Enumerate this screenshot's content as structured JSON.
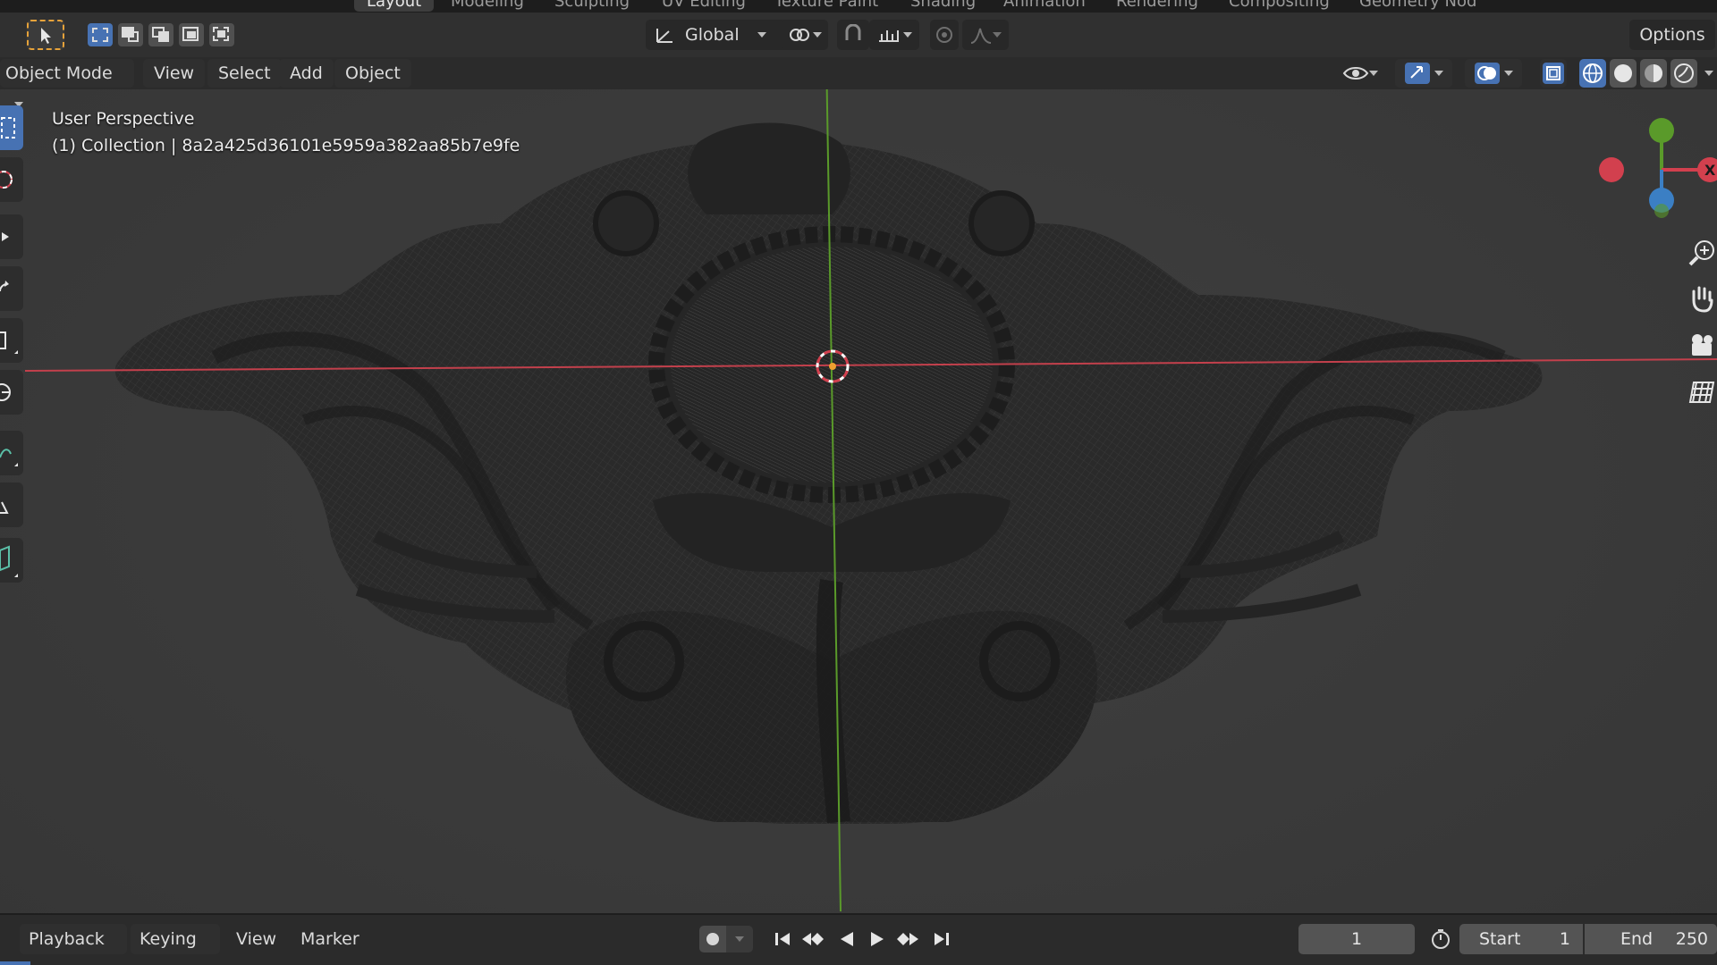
{
  "workspace_tabs": [
    {
      "label": "Layout",
      "active": true
    },
    {
      "label": "Modeling",
      "active": false
    },
    {
      "label": "Sculpting",
      "active": false
    },
    {
      "label": "UV Editing",
      "active": false
    },
    {
      "label": "Texture Paint",
      "active": false
    },
    {
      "label": "Shading",
      "active": false
    },
    {
      "label": "Animation",
      "active": false
    },
    {
      "label": "Rendering",
      "active": false
    },
    {
      "label": "Compositing",
      "active": false
    },
    {
      "label": "Geometry Nod",
      "active": false
    }
  ],
  "header": {
    "transform_orientation": "Global",
    "options_label": "Options"
  },
  "viewport_header": {
    "mode": "Object Mode",
    "menus": [
      "View",
      "Select",
      "Add",
      "Object"
    ]
  },
  "viewport": {
    "perspective_label": "User Perspective",
    "collection_label": "(1) Collection | 8a2a425d36101e5959a382aa85b7e9fe",
    "axis_x_color": "#d2404e",
    "axis_y_color": "#5a9a2a",
    "select_color": "#4772b3",
    "active_tool_color": "#e6a23a"
  },
  "left_toolbar": [
    "select-box",
    "cursor",
    "move",
    "rotate",
    "scale",
    "transform",
    "annotate",
    "measure",
    "add-cube"
  ],
  "nav_gizmo": {
    "x_label": "X",
    "x_color": "#d2404e",
    "y_color": "#5a9a2a",
    "z_color": "#3b7fc4"
  },
  "timeline": {
    "menus": [
      "Playback",
      "Keying",
      "View",
      "Marker"
    ],
    "current_frame": "1",
    "start_label": "Start",
    "start_value": "1",
    "end_label": "End",
    "end_value": "250"
  }
}
